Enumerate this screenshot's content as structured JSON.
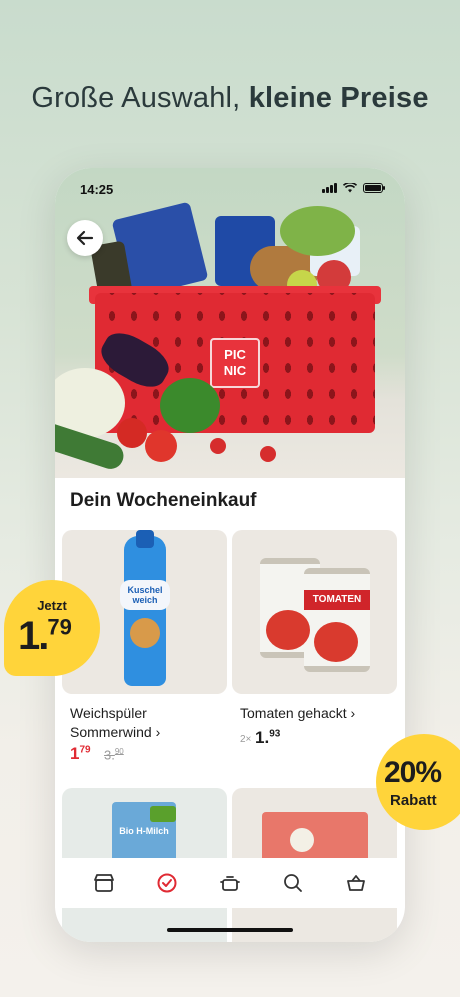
{
  "headline": {
    "regular": "Große Auswahl, ",
    "bold": "kleine Preise"
  },
  "status_bar": {
    "time": "14:25"
  },
  "hero": {
    "logo_text": "PIC NIC"
  },
  "section_title": "Dein Wocheneinkauf",
  "products": [
    {
      "name": "Weichspüler Sommerwind",
      "chevron": "›",
      "price_main": "1",
      "price_cents": "79",
      "old_main": "3.",
      "old_cents": "90",
      "image_label": "Kuschel weich"
    },
    {
      "name": "Tomaten gehackt",
      "chevron": "›",
      "qty": "2×",
      "price_main": "1.",
      "price_cents": "93",
      "image_label": "TOMATEN"
    },
    {
      "image_label": "Bio H-Milch"
    },
    {
      "image_label": ""
    }
  ],
  "badges": {
    "jetzt": {
      "label": "Jetzt",
      "main": "1.",
      "cents": "79"
    },
    "rabatt": {
      "percent": "20%",
      "text": "Rabatt"
    }
  },
  "tabbar": {
    "icons": [
      "shop-icon",
      "check-circle-icon",
      "pot-icon",
      "search-icon",
      "basket-icon"
    ]
  },
  "colors": {
    "brand_red": "#e02a33",
    "badge_yellow": "#ffd43a",
    "text_dark": "#1d1d1d"
  }
}
